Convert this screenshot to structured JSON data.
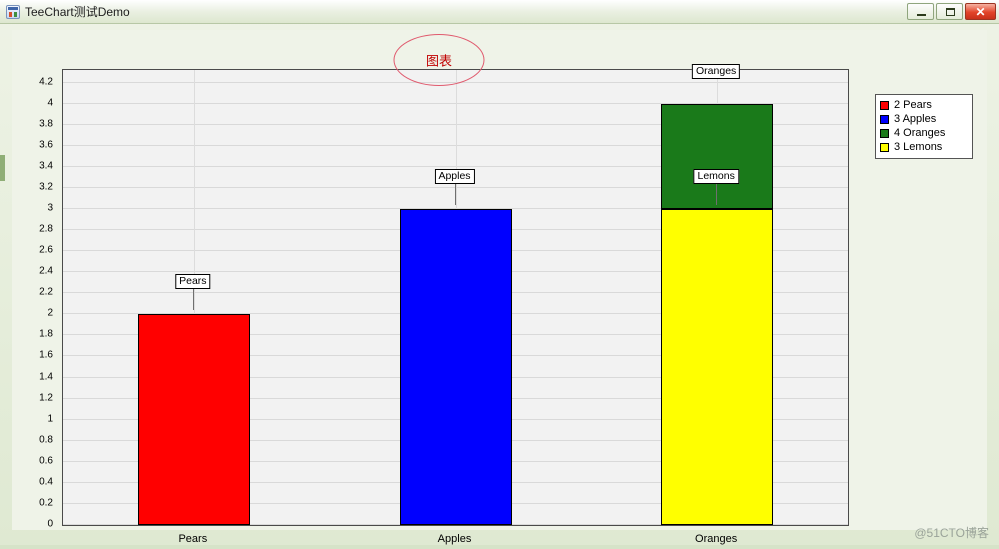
{
  "window": {
    "title": "TeeChart测试Demo",
    "icon": "app-icon",
    "buttons": {
      "minimize": "–",
      "maximize": "□",
      "close": "✕"
    }
  },
  "watermark": "@51CTO博客",
  "legend": {
    "items": [
      {
        "value": "2",
        "label": "Pears",
        "color": "#ff0000"
      },
      {
        "value": "3",
        "label": "Apples",
        "color": "#0000ff"
      },
      {
        "value": "4",
        "label": "Oranges",
        "color": "#1a7a1a"
      },
      {
        "value": "3",
        "label": "Lemons",
        "color": "#ffff00"
      }
    ]
  },
  "chart_data": {
    "type": "bar",
    "title": "图表",
    "xlabel": "",
    "ylabel": "",
    "ylim": [
      0,
      4.3
    ],
    "grid": true,
    "legend_position": "right",
    "categories": [
      "Pears",
      "Apples",
      "Oranges"
    ],
    "series": [
      {
        "name": "Oranges",
        "values": [
          null,
          null,
          4
        ],
        "color": "#1a7a1a",
        "mark": "Oranges"
      },
      {
        "name": "Lemons",
        "values": [
          null,
          null,
          3
        ],
        "color": "#ffff00",
        "mark": "Lemons"
      },
      {
        "name": "Apples",
        "values": [
          null,
          3,
          null
        ],
        "color": "#0000ff",
        "mark": "Apples"
      },
      {
        "name": "Pears",
        "values": [
          2,
          null,
          null
        ],
        "color": "#ff0000",
        "mark": "Pears"
      }
    ],
    "bars": [
      {
        "category": "Pears",
        "value": 2,
        "color": "#ff0000",
        "mark": "Pears"
      },
      {
        "category": "Apples",
        "value": 3,
        "color": "#0000ff",
        "mark": "Apples"
      },
      {
        "category": "Oranges",
        "value": 4,
        "color": "#1a7a1a",
        "mark": "Oranges",
        "stacked_below": {
          "value": 3,
          "color": "#ffff00",
          "mark": "Lemons"
        }
      }
    ],
    "ytick_labels": [
      "0",
      "0.2",
      "0.4",
      "0.6",
      "0.8",
      "1",
      "1.2",
      "1.4",
      "1.6",
      "1.8",
      "2",
      "2.2",
      "2.4",
      "2.6",
      "2.8",
      "3",
      "3.2",
      "3.4",
      "3.6",
      "3.8",
      "4",
      "4.2"
    ],
    "ytick_values": [
      0,
      0.2,
      0.4,
      0.6,
      0.8,
      1,
      1.2,
      1.4,
      1.6,
      1.8,
      2,
      2.2,
      2.4,
      2.6,
      2.8,
      3,
      3.2,
      3.4,
      3.6,
      3.8,
      4,
      4.2
    ],
    "xtick_labels": [
      "Pears",
      "Apples",
      "Oranges"
    ]
  }
}
